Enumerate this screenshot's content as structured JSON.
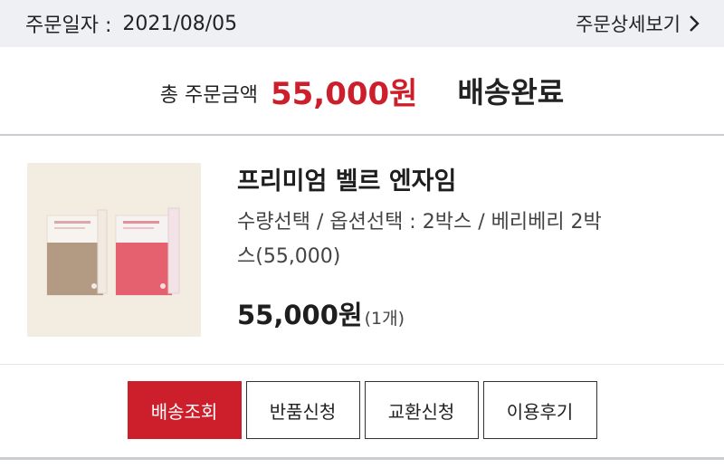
{
  "order": {
    "date_label": "주문일자 :",
    "date_value": "2021/08/05",
    "detail_link": "주문상세보기"
  },
  "summary": {
    "total_label": "총 주문금액",
    "total_amount": "55,000원",
    "status": "배송완료"
  },
  "product": {
    "name": "프리미엄 벨르 엔자임",
    "option_line1": "수량선택 / 옵션선택 : 2박스 / 베리베리 2박",
    "option_line2": "스(55,000)",
    "price": "55,000원",
    "quantity": "(1개)"
  },
  "actions": {
    "track": "배송조회",
    "return": "반품신청",
    "exchange": "교환신청",
    "review": "이용후기"
  },
  "colors": {
    "accent": "#cc1f2b",
    "header_bg": "#eef0f3",
    "thumb_bg": "#f3ece0"
  },
  "icons": {
    "detail_link": "chevron-right-icon",
    "thumbnail": "product-image"
  }
}
